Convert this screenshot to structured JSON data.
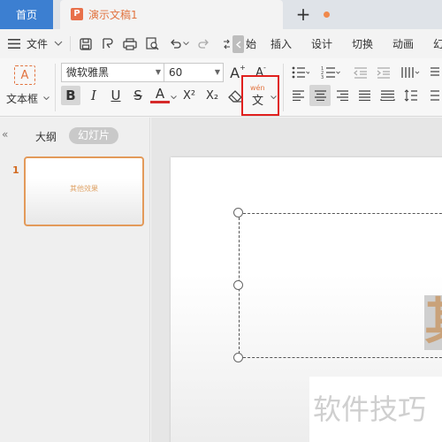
{
  "tabs": {
    "home": "首页",
    "document": "演示文稿1",
    "ppt_badge": "P"
  },
  "menu": {
    "file": "文件",
    "items": [
      "插入",
      "设计",
      "切换",
      "动画",
      "幻"
    ]
  },
  "ribbon": {
    "textbox_label": "文本框",
    "textbox_glyph": "A",
    "font_family": "微软雅黑",
    "font_size": "60",
    "bold": "B",
    "italic": "I",
    "underline": "U",
    "strikethrough": "S",
    "font_color": "A",
    "superscript": "X²",
    "subscript": "X₂",
    "pinyin_top": "wén",
    "pinyin_char": "文",
    "grow_font": "A",
    "shrink_font": "A"
  },
  "sidebar": {
    "collapse": "«",
    "tab_outline": "大纲",
    "tab_slides": "幻灯片",
    "slide_number": "1",
    "thumb_text": "其他效果"
  },
  "canvas": {
    "big_char": "其"
  },
  "watermark": "软件技巧",
  "colors": {
    "accent_blue": "#3c7fd1",
    "accent_orange": "#e2733f",
    "highlight_red": "#e0201e"
  }
}
